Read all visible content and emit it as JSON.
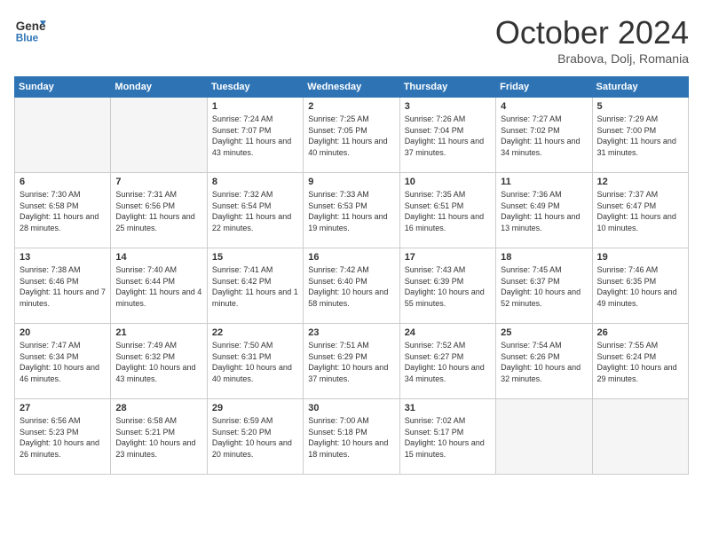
{
  "header": {
    "logo_line1": "General",
    "logo_line2": "Blue",
    "month": "October 2024",
    "location": "Brabova, Dolj, Romania"
  },
  "weekdays": [
    "Sunday",
    "Monday",
    "Tuesday",
    "Wednesday",
    "Thursday",
    "Friday",
    "Saturday"
  ],
  "weeks": [
    [
      {
        "day": "",
        "info": ""
      },
      {
        "day": "",
        "info": ""
      },
      {
        "day": "1",
        "info": "Sunrise: 7:24 AM\nSunset: 7:07 PM\nDaylight: 11 hours and 43 minutes."
      },
      {
        "day": "2",
        "info": "Sunrise: 7:25 AM\nSunset: 7:05 PM\nDaylight: 11 hours and 40 minutes."
      },
      {
        "day": "3",
        "info": "Sunrise: 7:26 AM\nSunset: 7:04 PM\nDaylight: 11 hours and 37 minutes."
      },
      {
        "day": "4",
        "info": "Sunrise: 7:27 AM\nSunset: 7:02 PM\nDaylight: 11 hours and 34 minutes."
      },
      {
        "day": "5",
        "info": "Sunrise: 7:29 AM\nSunset: 7:00 PM\nDaylight: 11 hours and 31 minutes."
      }
    ],
    [
      {
        "day": "6",
        "info": "Sunrise: 7:30 AM\nSunset: 6:58 PM\nDaylight: 11 hours and 28 minutes."
      },
      {
        "day": "7",
        "info": "Sunrise: 7:31 AM\nSunset: 6:56 PM\nDaylight: 11 hours and 25 minutes."
      },
      {
        "day": "8",
        "info": "Sunrise: 7:32 AM\nSunset: 6:54 PM\nDaylight: 11 hours and 22 minutes."
      },
      {
        "day": "9",
        "info": "Sunrise: 7:33 AM\nSunset: 6:53 PM\nDaylight: 11 hours and 19 minutes."
      },
      {
        "day": "10",
        "info": "Sunrise: 7:35 AM\nSunset: 6:51 PM\nDaylight: 11 hours and 16 minutes."
      },
      {
        "day": "11",
        "info": "Sunrise: 7:36 AM\nSunset: 6:49 PM\nDaylight: 11 hours and 13 minutes."
      },
      {
        "day": "12",
        "info": "Sunrise: 7:37 AM\nSunset: 6:47 PM\nDaylight: 11 hours and 10 minutes."
      }
    ],
    [
      {
        "day": "13",
        "info": "Sunrise: 7:38 AM\nSunset: 6:46 PM\nDaylight: 11 hours and 7 minutes."
      },
      {
        "day": "14",
        "info": "Sunrise: 7:40 AM\nSunset: 6:44 PM\nDaylight: 11 hours and 4 minutes."
      },
      {
        "day": "15",
        "info": "Sunrise: 7:41 AM\nSunset: 6:42 PM\nDaylight: 11 hours and 1 minute."
      },
      {
        "day": "16",
        "info": "Sunrise: 7:42 AM\nSunset: 6:40 PM\nDaylight: 10 hours and 58 minutes."
      },
      {
        "day": "17",
        "info": "Sunrise: 7:43 AM\nSunset: 6:39 PM\nDaylight: 10 hours and 55 minutes."
      },
      {
        "day": "18",
        "info": "Sunrise: 7:45 AM\nSunset: 6:37 PM\nDaylight: 10 hours and 52 minutes."
      },
      {
        "day": "19",
        "info": "Sunrise: 7:46 AM\nSunset: 6:35 PM\nDaylight: 10 hours and 49 minutes."
      }
    ],
    [
      {
        "day": "20",
        "info": "Sunrise: 7:47 AM\nSunset: 6:34 PM\nDaylight: 10 hours and 46 minutes."
      },
      {
        "day": "21",
        "info": "Sunrise: 7:49 AM\nSunset: 6:32 PM\nDaylight: 10 hours and 43 minutes."
      },
      {
        "day": "22",
        "info": "Sunrise: 7:50 AM\nSunset: 6:31 PM\nDaylight: 10 hours and 40 minutes."
      },
      {
        "day": "23",
        "info": "Sunrise: 7:51 AM\nSunset: 6:29 PM\nDaylight: 10 hours and 37 minutes."
      },
      {
        "day": "24",
        "info": "Sunrise: 7:52 AM\nSunset: 6:27 PM\nDaylight: 10 hours and 34 minutes."
      },
      {
        "day": "25",
        "info": "Sunrise: 7:54 AM\nSunset: 6:26 PM\nDaylight: 10 hours and 32 minutes."
      },
      {
        "day": "26",
        "info": "Sunrise: 7:55 AM\nSunset: 6:24 PM\nDaylight: 10 hours and 29 minutes."
      }
    ],
    [
      {
        "day": "27",
        "info": "Sunrise: 6:56 AM\nSunset: 5:23 PM\nDaylight: 10 hours and 26 minutes."
      },
      {
        "day": "28",
        "info": "Sunrise: 6:58 AM\nSunset: 5:21 PM\nDaylight: 10 hours and 23 minutes."
      },
      {
        "day": "29",
        "info": "Sunrise: 6:59 AM\nSunset: 5:20 PM\nDaylight: 10 hours and 20 minutes."
      },
      {
        "day": "30",
        "info": "Sunrise: 7:00 AM\nSunset: 5:18 PM\nDaylight: 10 hours and 18 minutes."
      },
      {
        "day": "31",
        "info": "Sunrise: 7:02 AM\nSunset: 5:17 PM\nDaylight: 10 hours and 15 minutes."
      },
      {
        "day": "",
        "info": ""
      },
      {
        "day": "",
        "info": ""
      }
    ]
  ]
}
